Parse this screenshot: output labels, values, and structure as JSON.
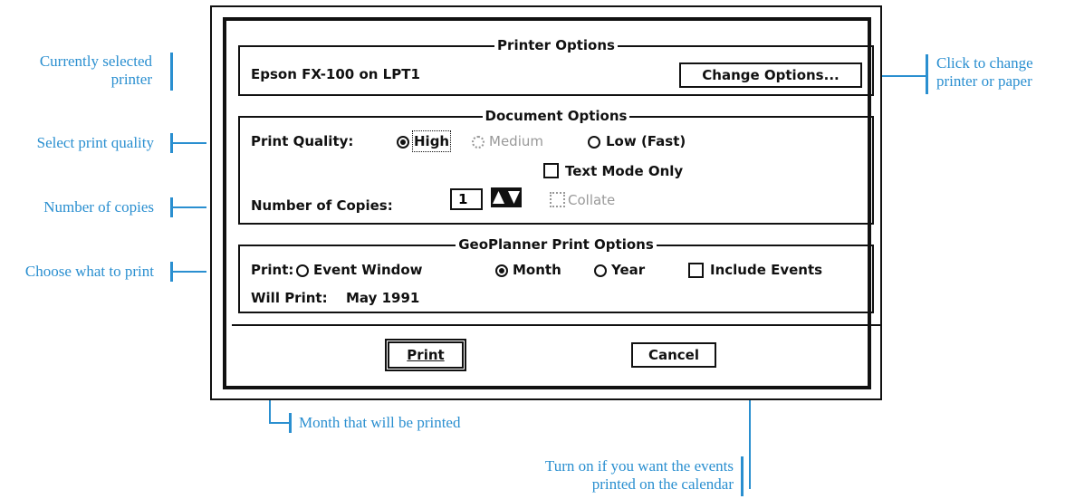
{
  "annotations": {
    "current_printer": [
      "Currently selected",
      "printer"
    ],
    "print_quality": "Select print quality",
    "copies": "Number of copies",
    "what_to_print": "Choose what to print",
    "change": [
      "Click to change",
      "printer or paper"
    ],
    "month": "Month that will be printed",
    "events": [
      "Turn on if you want the events",
      "printed on the calendar"
    ]
  },
  "printer_options": {
    "title": "Printer Options",
    "printer_name": "Epson FX-100 on LPT1",
    "change_button": "Change Options..."
  },
  "document_options": {
    "title": "Document Options",
    "quality_label": "Print Quality:",
    "quality_options": [
      "High",
      "Medium",
      "Low (Fast)"
    ],
    "quality_selected": "High",
    "text_mode": "Text Mode Only",
    "copies_label": "Number of Copies:",
    "copies_value": "1",
    "collate": "Collate"
  },
  "geoplanner": {
    "title": "GeoPlanner Print Options",
    "print_label": "Print:",
    "print_options": [
      "Event Window",
      "Month",
      "Year"
    ],
    "print_selected": "Month",
    "include_events": "Include Events",
    "will_print_label": "Will Print:",
    "will_print_value": "May 1991"
  },
  "buttons": {
    "print": "Print",
    "cancel": "Cancel"
  },
  "colors": {
    "annotation": "#2a8fd0",
    "dialog": "#111111"
  }
}
